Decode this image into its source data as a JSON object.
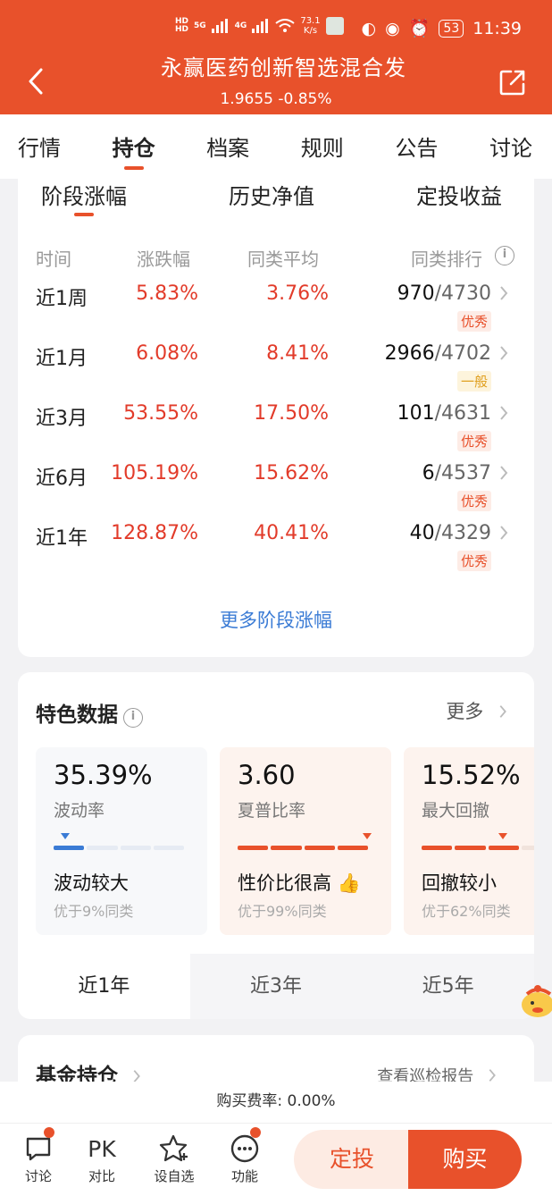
{
  "status": {
    "hd1": "HD",
    "hd2": "HD",
    "net1": "5G",
    "net2": "4G",
    "speed_num": "73.1",
    "speed_unit": "K/s",
    "battery": "53",
    "time": "11:39"
  },
  "header": {
    "title": "永赢医药创新智选混合发",
    "nav_line": "1.9655 -0.85%"
  },
  "tabs": [
    "行情",
    "持仓",
    "档案",
    "规则",
    "公告",
    "讨论"
  ],
  "subtabs": [
    "阶段涨幅",
    "历史净值",
    "定投收益"
  ],
  "table": {
    "headers": [
      "时间",
      "涨跌幅",
      "同类平均",
      "同类排行"
    ],
    "rows": [
      {
        "period": "近1周",
        "change": "5.83%",
        "avg": "3.76%",
        "rank": "970",
        "total": "/4730",
        "badge": "优秀",
        "badge_type": "good"
      },
      {
        "period": "近1月",
        "change": "6.08%",
        "avg": "8.41%",
        "rank": "2966",
        "total": "/4702",
        "badge": "一般",
        "badge_type": "avg"
      },
      {
        "period": "近3月",
        "change": "53.55%",
        "avg": "17.50%",
        "rank": "101",
        "total": "/4631",
        "badge": "优秀",
        "badge_type": "good"
      },
      {
        "period": "近6月",
        "change": "105.19%",
        "avg": "15.62%",
        "rank": "6",
        "total": "/4537",
        "badge": "优秀",
        "badge_type": "good"
      },
      {
        "period": "近1年",
        "change": "128.87%",
        "avg": "40.41%",
        "rank": "40",
        "total": "/4329",
        "badge": "优秀",
        "badge_type": "good"
      }
    ],
    "more_link": "更多阶段涨幅"
  },
  "features": {
    "title": "特色数据",
    "more": "更多",
    "cards": [
      {
        "value": "35.39%",
        "label": "波动率",
        "desc": "波动较大",
        "sub": "优于9%同类",
        "level": 0.08
      },
      {
        "value": "3.60",
        "label": "夏普比率",
        "desc": "性价比很高",
        "sub": "优于99%同类",
        "level": 0.99
      },
      {
        "value": "15.52%",
        "label": "最大回撤",
        "desc": "回撤较小",
        "sub": "优于62%同类",
        "level": 0.62
      }
    ],
    "periods": [
      "近1年",
      "近3年",
      "近5年"
    ]
  },
  "holdings": {
    "title": "基金持仓",
    "report_link": "查看巡检报告"
  },
  "fee": "购买费率: 0.00%",
  "bottom": {
    "items": [
      {
        "label": "讨论",
        "icon": "chat-icon"
      },
      {
        "label": "对比",
        "icon": "pk-icon",
        "glyph": "PK"
      },
      {
        "label": "设自选",
        "icon": "star-add-icon"
      },
      {
        "label": "功能",
        "icon": "more-icon"
      }
    ],
    "dingtou": "定投",
    "buy": "购买"
  },
  "colors": {
    "brand": "#e8512b",
    "up": "#e23b2a",
    "link": "#3a7bd5"
  }
}
